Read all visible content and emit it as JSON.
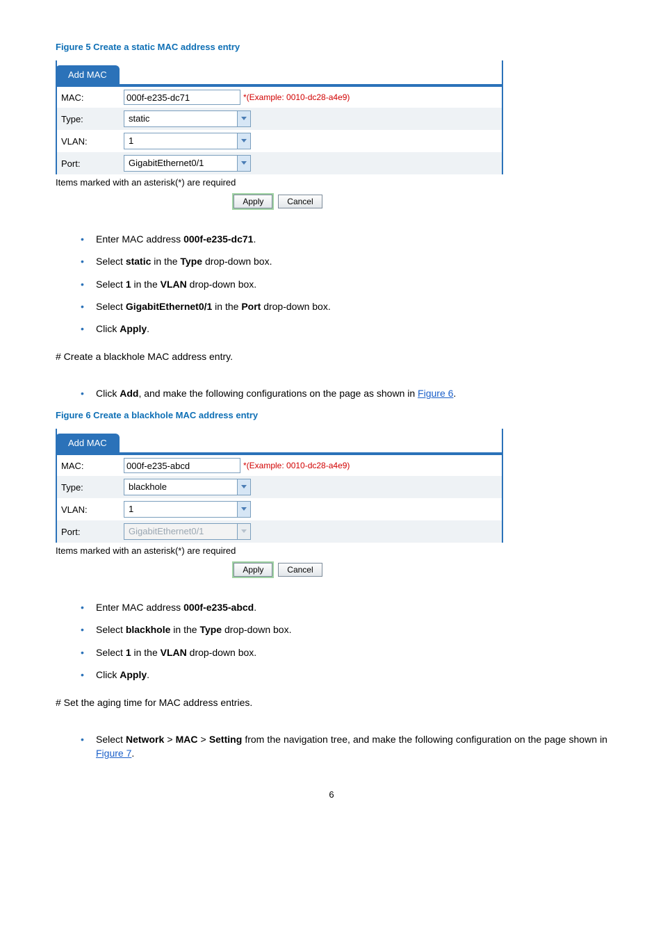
{
  "figure5": {
    "title": "Figure 5 Create a static MAC address entry",
    "tab": "Add MAC",
    "mac_label": "MAC:",
    "mac_value": "000f-e235-dc71",
    "mac_example": "*(Example: 0010-dc28-a4e9)",
    "type_label": "Type:",
    "type_value": "static",
    "vlan_label": "VLAN:",
    "vlan_value": "1",
    "port_label": "Port:",
    "port_value": "GigabitEthernet0/1",
    "req_note": "Items marked with an asterisk(*) are required",
    "apply": "Apply",
    "cancel": "Cancel"
  },
  "steps1": {
    "l1_a": "Enter MAC address ",
    "l1_b": "000f-e235-dc71",
    "l1_c": ".",
    "l2_a": "Select ",
    "l2_b": "static",
    "l2_c": " in the ",
    "l2_d": "Type",
    "l2_e": " drop-down box.",
    "l3_a": "Select ",
    "l3_b": "1",
    "l3_c": " in the ",
    "l3_d": "VLAN",
    "l3_e": " drop-down box.",
    "l4_a": "Select ",
    "l4_b": "GigabitEthernet0/1",
    "l4_c": " in the ",
    "l4_d": "Port",
    "l4_e": " drop-down box.",
    "l5_a": "Click ",
    "l5_b": "Apply",
    "l5_c": "."
  },
  "para1": "# Create a blackhole MAC address entry.",
  "step_add": {
    "a": "Click ",
    "b": "Add",
    "c": ", and make the following configurations on the page as shown in ",
    "link": "Figure 6",
    "d": "."
  },
  "figure6": {
    "title": "Figure 6 Create a blackhole MAC address entry",
    "tab": "Add MAC",
    "mac_label": "MAC:",
    "mac_value": "000f-e235-abcd",
    "mac_example": "*(Example: 0010-dc28-a4e9)",
    "type_label": "Type:",
    "type_value": "blackhole",
    "vlan_label": "VLAN:",
    "vlan_value": "1",
    "port_label": "Port:",
    "port_value": "GigabitEthernet0/1",
    "req_note": "Items marked with an asterisk(*) are required",
    "apply": "Apply",
    "cancel": "Cancel"
  },
  "steps2": {
    "l1_a": "Enter MAC address ",
    "l1_b": "000f-e235-abcd",
    "l1_c": ".",
    "l2_a": "Select ",
    "l2_b": "blackhole",
    "l2_c": " in the ",
    "l2_d": "Type",
    "l2_e": " drop-down box.",
    "l3_a": "Select ",
    "l3_b": "1",
    "l3_c": " in the ",
    "l3_d": "VLAN",
    "l3_e": " drop-down box.",
    "l4_a": "Click ",
    "l4_b": "Apply",
    "l4_c": "."
  },
  "para2": "# Set the aging time for MAC address entries.",
  "step_nav": {
    "a": "Select ",
    "net": "Network",
    "gt1": " > ",
    "mac": "MAC",
    "gt2": " > ",
    "setting": "Setting",
    "b": " from the navigation tree, and make the following configuration on the page shown in ",
    "link": "Figure 7",
    "c": "."
  },
  "page_num": "6"
}
